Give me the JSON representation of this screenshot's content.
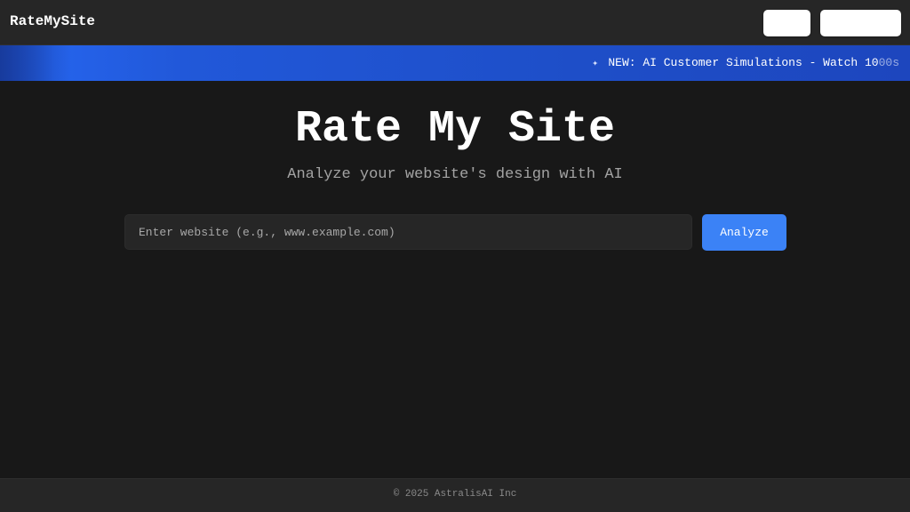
{
  "header": {
    "brand": "RateMySite",
    "nav_buttons": [
      "",
      ""
    ]
  },
  "banner": {
    "icon": "sparkle-icon",
    "text": "NEW: AI Customer Simulations - Watch 10",
    "text_fade": "00s"
  },
  "hero": {
    "title": "Rate My Site",
    "subtitle": "Analyze your website's design with AI"
  },
  "search": {
    "placeholder": "Enter website (e.g., www.example.com)",
    "value": "",
    "button_label": "Analyze"
  },
  "footer": {
    "copyright": "© 2025 AstralisAI Inc"
  },
  "colors": {
    "background": "#181818",
    "header_bg": "#262626",
    "banner": "#2158d9",
    "accent_button": "#3b82f6",
    "subtitle": "#a3a3a3"
  }
}
